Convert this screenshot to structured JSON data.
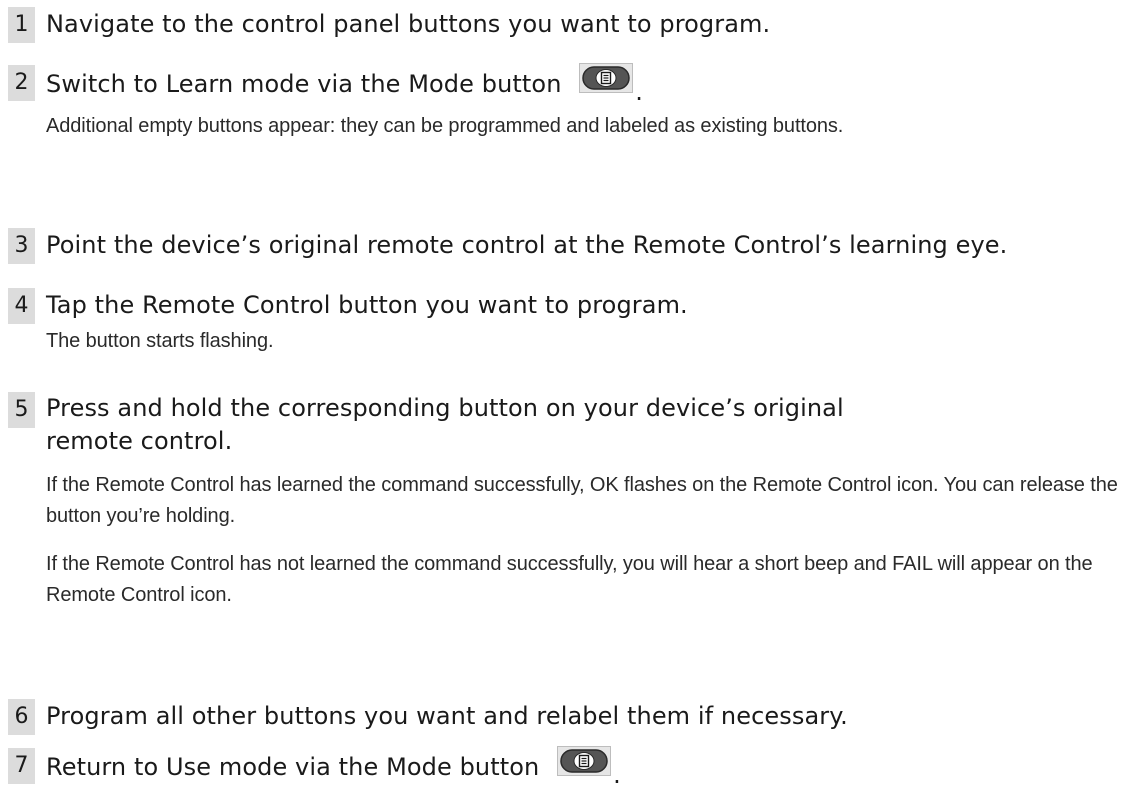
{
  "steps": [
    {
      "number": "1",
      "title": "Navigate to the control panel buttons you want to program.",
      "paragraphs": []
    },
    {
      "number": "2",
      "title": "Switch to Learn mode via the Mode button",
      "title_suffix": ".",
      "icon": "mode-button-icon",
      "paragraphs": [
        "Additional empty buttons appear: they can be programmed and labeled as existing buttons."
      ]
    },
    {
      "number": "3",
      "title": "Point the device’s original remote control at the Remote Control’s learning eye.",
      "paragraphs": []
    },
    {
      "number": "4",
      "title": "Tap the Remote Control button you want to program.",
      "paragraphs": [
        "The button starts flashing."
      ]
    },
    {
      "number": "5",
      "title": "Press and hold the corresponding button on your device’s original remote control.",
      "paragraphs": [
        "If the Remote Control has learned the command successfully, OK flashes on the Remote Control icon. You can release the button you’re holding.",
        "If the Remote Control has not learned the command successfully, you will hear a short beep and FAIL will appear on the Remote Control icon."
      ]
    },
    {
      "number": "6",
      "title": "Program all other buttons you want and relabel them if necessary.",
      "paragraphs": []
    },
    {
      "number": "7",
      "title": "Return to Use mode via the Mode button",
      "title_suffix": ".",
      "icon": "mode-button-icon",
      "paragraphs": []
    }
  ],
  "colors": {
    "number_badge_bg": "#dcdcdc",
    "text": "#1a1a1a",
    "body_text": "#2a2a2a",
    "icon_button_fill": "#555555"
  }
}
